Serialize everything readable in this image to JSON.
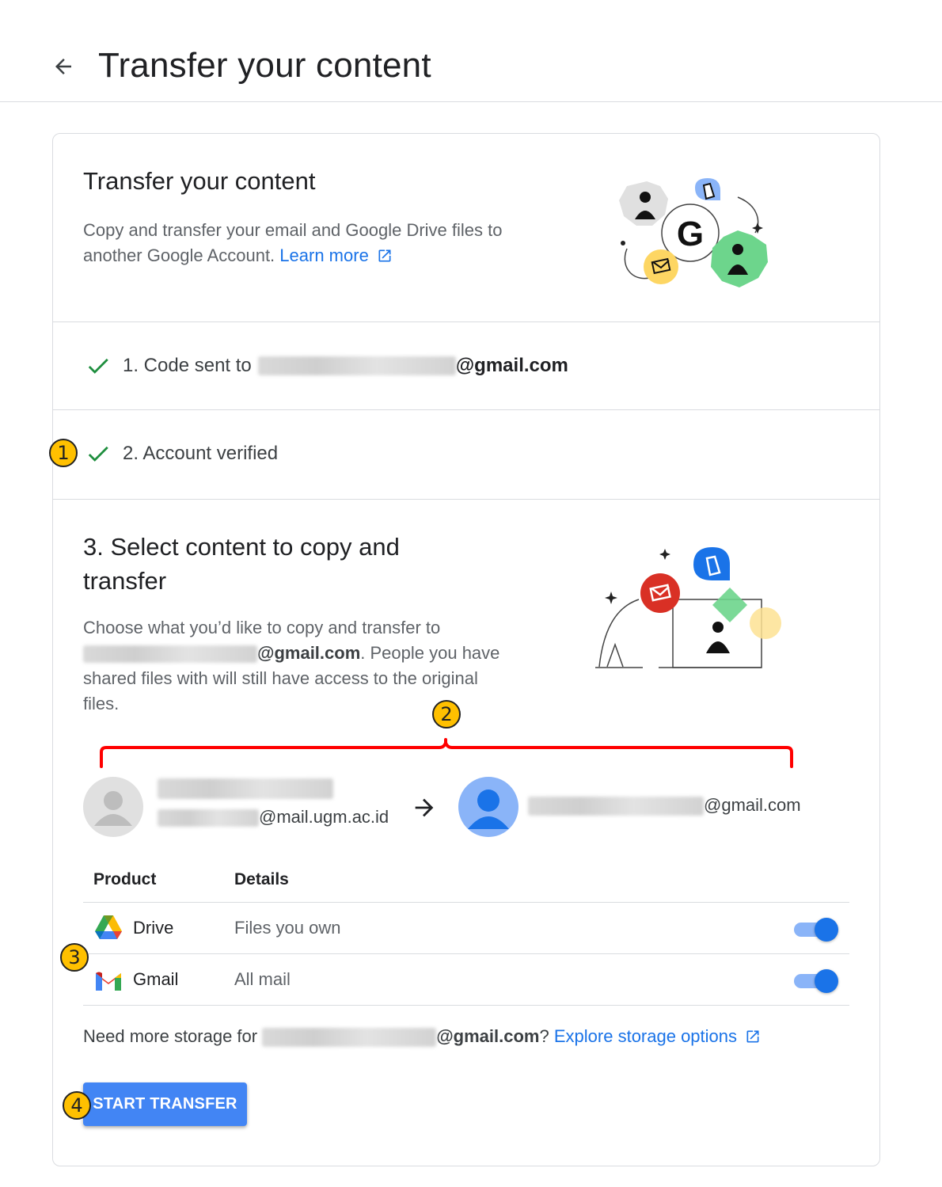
{
  "header": {
    "title": "Transfer your content"
  },
  "intro": {
    "title": "Transfer your content",
    "description": "Copy and transfer your email and Google Drive files to another Google Account.",
    "learn_more": "Learn more"
  },
  "steps": {
    "step1_label": "1. Code sent to",
    "step1_email_suffix": "@gmail.com",
    "step2_label": "2. Account verified",
    "step3_title": "3. Select content to copy and transfer",
    "step3_desc_lead": "Choose what you’d like to copy and transfer to",
    "step3_desc_email_suffix": "@gmail.com",
    "step3_desc_tail": ". People you have shared files with will still have access to the original files."
  },
  "accounts": {
    "source_email_suffix": "@mail.ugm.ac.id",
    "destination_email_suffix": "@gmail.com"
  },
  "table": {
    "headers": {
      "product": "Product",
      "details": "Details"
    },
    "rows": [
      {
        "product": "Drive",
        "details": "Files you own",
        "enabled": true,
        "icon": "google-drive-icon"
      },
      {
        "product": "Gmail",
        "details": "All mail",
        "enabled": true,
        "icon": "gmail-icon"
      }
    ]
  },
  "storage": {
    "lead": "Need more storage for",
    "email_suffix": "@gmail.com",
    "question": "?",
    "link": "Explore storage options"
  },
  "actions": {
    "start_transfer": "START TRANSFER"
  },
  "annotations": {
    "badge1": "1",
    "badge2": "2",
    "badge3": "3",
    "badge4": "4"
  },
  "colors": {
    "link": "#1a73e8",
    "primary_button": "#4285f4",
    "check": "#1e8e3e",
    "annotation_badge": "#ffc000",
    "annotation_bracket": "#ff0000"
  }
}
